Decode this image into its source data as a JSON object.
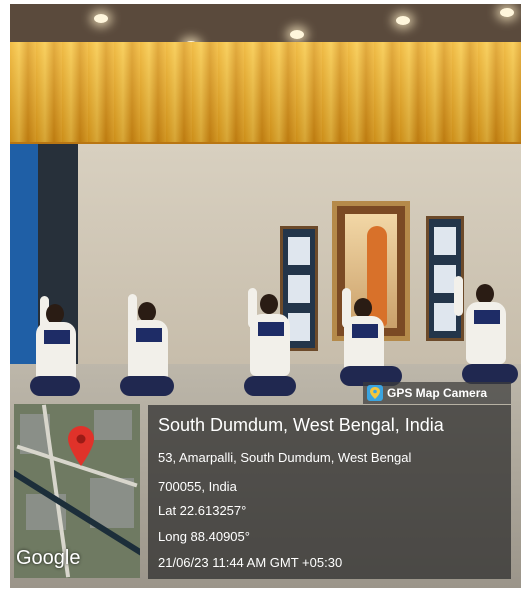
{
  "gps_stamp": {
    "app_label": "GPS Map Camera",
    "location_title": "South Dumdum, West Bengal, India",
    "address_line_1": "53, Amarpalli, South Dumdum, West Bengal",
    "address_line_2": "700055, India",
    "latitude": "Lat 22.613257°",
    "longitude": "Long 88.40905°",
    "timestamp": "21/06/23 11:44 AM GMT +05:30",
    "map_logo": "Google"
  },
  "colors": {
    "curtain": "#e8a51c",
    "marker": "#e0322a",
    "app_icon": "#3aa4e0"
  },
  "icons": {
    "app": "map-pin-icon",
    "marker": "location-marker-icon"
  }
}
